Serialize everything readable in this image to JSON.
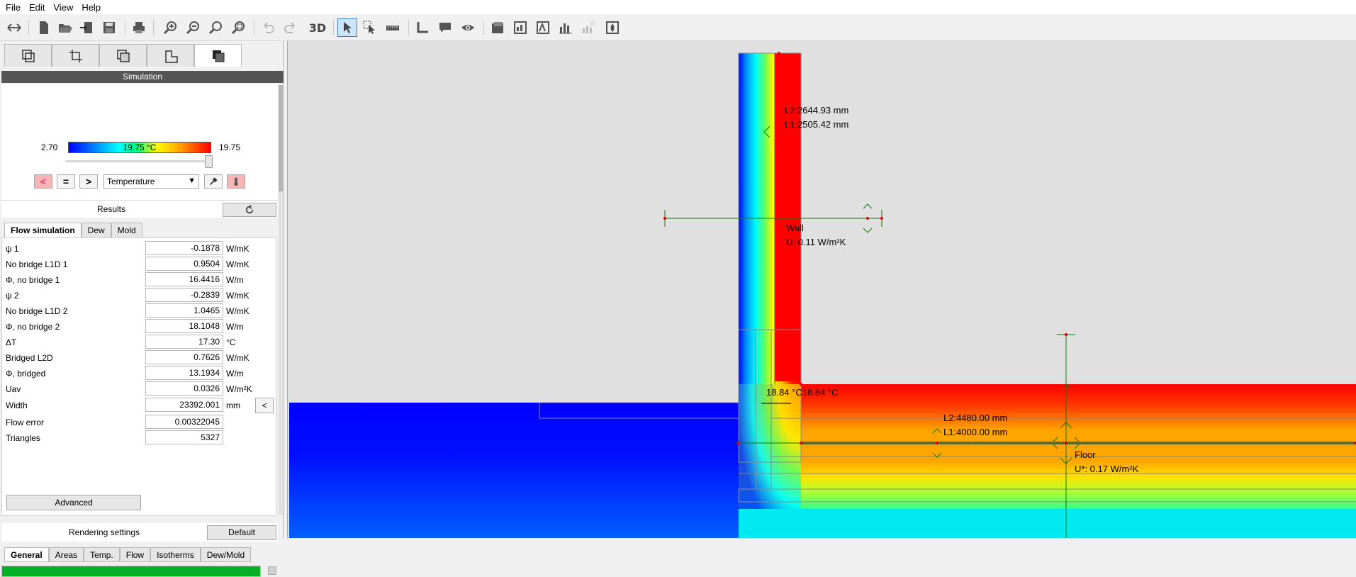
{
  "menu": [
    "File",
    "Edit",
    "View",
    "Help"
  ],
  "toolbar": {
    "btn_3d": "3D"
  },
  "simulation": {
    "header": "Simulation",
    "scale_min": "2.70",
    "scale_max": "19.75",
    "colorbar_value": "19.75 °C",
    "slider_fraction": 1.0,
    "btn_prev": "<",
    "btn_eq": "=",
    "btn_next": ">",
    "quantity": "Temperature"
  },
  "results": {
    "label": "Results",
    "tabs": [
      "Flow simulation",
      "Dew",
      "Mold"
    ],
    "rows": [
      {
        "name": "ψ 1",
        "value": "-0.1878",
        "unit": "W/mK"
      },
      {
        "name": "No bridge L1D 1",
        "value": "0.9504",
        "unit": "W/mK"
      },
      {
        "name": "Φ, no bridge 1",
        "value": "16.4416",
        "unit": "W/m"
      },
      {
        "name": "ψ 2",
        "value": "-0.2839",
        "unit": "W/mK"
      },
      {
        "name": "No bridge L1D 2",
        "value": "1.0465",
        "unit": "W/mK"
      },
      {
        "name": "Φ, no bridge 2",
        "value": "18.1048",
        "unit": "W/m"
      },
      {
        "name": "ΔT",
        "value": "17.30",
        "unit": "°C"
      },
      {
        "name": "Bridged L2D",
        "value": "0.7626",
        "unit": "W/mK"
      },
      {
        "name": "Φ, bridged",
        "value": "13.1934",
        "unit": "W/m"
      },
      {
        "name": "Uav",
        "value": "0.0326",
        "unit": "W/m²K"
      },
      {
        "name": "Width",
        "value": "23392.001",
        "unit": "mm"
      },
      {
        "name": "Flow error",
        "value": "0.00322045",
        "unit": ""
      },
      {
        "name": "Triangles",
        "value": "5327",
        "unit": ""
      }
    ],
    "width_btn": "<",
    "advanced": "Advanced"
  },
  "rendering": {
    "label": "Rendering settings",
    "default_btn": "Default",
    "tabs": [
      "General",
      "Areas",
      "Temp.",
      "Flow",
      "Isotherms",
      "Dew/Mold"
    ]
  },
  "progress_fraction": 1.0,
  "canvas": {
    "wall_l2": "L2:2644.93 mm",
    "wall_l1": "L1:2505.42 mm",
    "wall_name": "Wall",
    "wall_u": "U: 0.11 W/m²K",
    "corner_temp": "18.84 °C18.84 °C",
    "floor_l2": "L2:4480.00 mm",
    "floor_l1": "L1:4000.00 mm",
    "floor_name": "Floor",
    "floor_u": "U*: 0.17 W/m²K"
  },
  "colors": {
    "progress": "#06b025",
    "sim_header": "#555555",
    "ground": "#0000ff",
    "insulation_hot": "#ff0000"
  }
}
